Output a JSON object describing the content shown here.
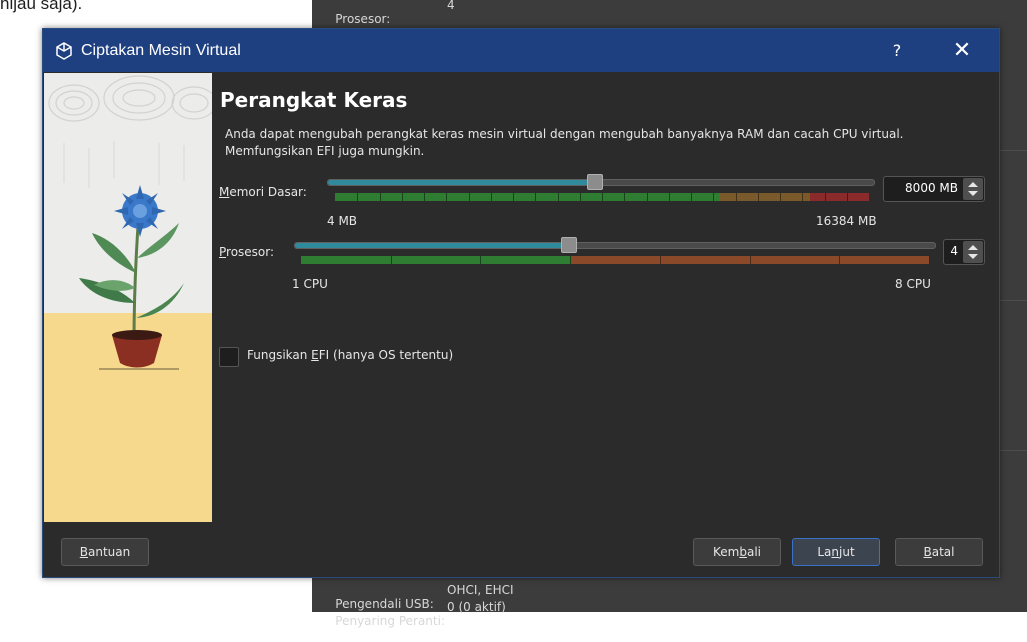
{
  "background": {
    "caption_fragment": "hijau saja).",
    "host_rows": [
      {
        "label": "Prosesor:",
        "value": "4"
      },
      {
        "label": "Pengendali USB:",
        "value": "OHCI, EHCI"
      },
      {
        "label": "Penyaring Peranti:",
        "value": "0 (0 aktif)"
      }
    ]
  },
  "dialog": {
    "title": "Ciptakan Mesin Virtual",
    "title_icon": "virtualbox-cube-icon",
    "help_label": "?",
    "close_label": "✕",
    "page_title": "Perangkat Keras",
    "description": "Anda dapat mengubah perangkat keras mesin virtual dengan mengubah banyaknya RAM dan cacah CPU virtual. Memfungsikan EFI juga mungkin.",
    "memory": {
      "label_accel": "M",
      "label_rest": "emori Dasar:",
      "min_label": "4 MB",
      "max_label": "16384 MB",
      "value_text": "8000 MB",
      "value": 8000,
      "min": 4,
      "max": 16384,
      "colors": {
        "green": "#2e7d32",
        "orange": "#7a5a2a",
        "red": "#8a2a2a"
      }
    },
    "processor": {
      "label_accel": "P",
      "label_rest": "rosesor:",
      "min_label": "1 CPU",
      "max_label": "8 CPU",
      "value_text": "4",
      "value": 4,
      "min": 1,
      "max": 8,
      "colors": {
        "green": "#2e7d32",
        "orange": "#8a4a2a"
      }
    },
    "efi": {
      "label_pre": "Fungsikan ",
      "label_accel": "E",
      "label_post": "FI (hanya OS tertentu)",
      "checked": false
    },
    "buttons": {
      "help": {
        "pre": "",
        "accel": "B",
        "post": "antuan"
      },
      "back": {
        "pre": "Kem",
        "accel": "b",
        "post": "ali"
      },
      "next": {
        "pre": "La",
        "accel": "n",
        "post": "jut"
      },
      "cancel": {
        "pre": "",
        "accel": "B",
        "post": "atal"
      }
    }
  }
}
